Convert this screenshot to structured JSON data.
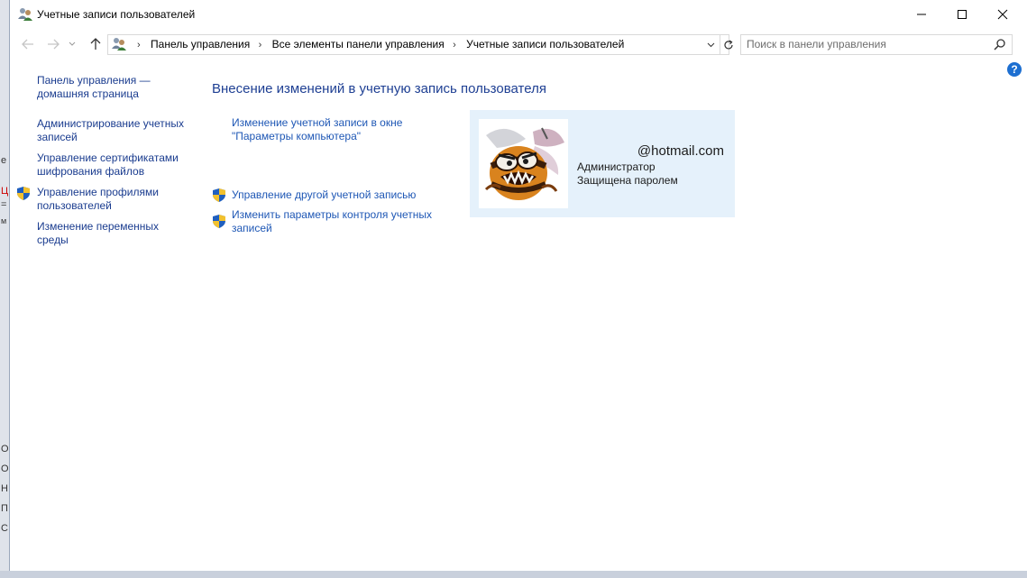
{
  "window": {
    "title": "Учетные записи пользователей"
  },
  "address": {
    "crumbs": [
      "Панель управления",
      "Все элементы панели управления",
      "Учетные записи пользователей"
    ]
  },
  "search": {
    "placeholder": "Поиск в панели управления"
  },
  "help": {
    "label": "?"
  },
  "sidebar": {
    "items": [
      {
        "label_lines": [
          "Панель управления —",
          "домашняя страница"
        ]
      },
      {
        "label_lines": [
          "Администрирование учетных",
          "записей"
        ]
      },
      {
        "label_lines": [
          "Управление сертификатами",
          "шифрования файлов"
        ]
      },
      {
        "label_lines": [
          "Управление профилями",
          "пользователей"
        ],
        "icon": "uac-shield-icon"
      },
      {
        "label_lines": [
          "Изменение переменных",
          "среды"
        ]
      }
    ]
  },
  "main": {
    "heading": "Внесение изменений в учетную запись пользователя",
    "links": [
      {
        "label_lines": [
          "Изменение учетной записи в окне",
          "\"Параметры компьютера\""
        ]
      },
      {
        "label_lines": [
          "Управление другой учетной записью"
        ],
        "icon": "uac-shield-icon"
      },
      {
        "label_lines": [
          "Изменить параметры контроля учетных",
          "записей"
        ],
        "icon": "uac-shield-icon"
      }
    ]
  },
  "account": {
    "email": "@hotmail.com",
    "role": "Администратор",
    "status": "Защищена паролем",
    "avatar_icon": "hornet-avatar-icon"
  },
  "background_fragments": [
    "е",
    "Ц",
    "=",
    "м",
    "О",
    "О",
    "Н",
    "П",
    "С"
  ],
  "colors": {
    "link": "#1a3c8f",
    "heading": "#1e3f93",
    "card": "#e5f1fb",
    "help": "#1d6fd1"
  }
}
